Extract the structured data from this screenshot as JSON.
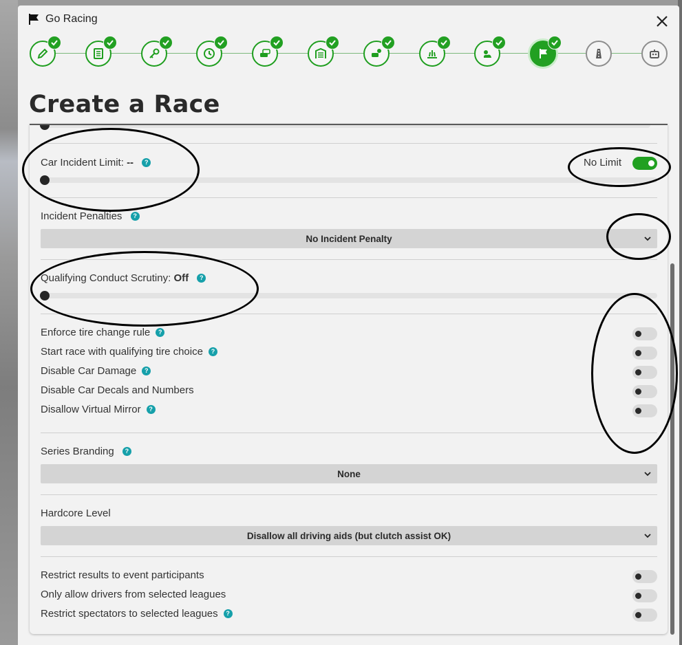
{
  "window": {
    "title": "Go Racing"
  },
  "steps": [
    {
      "icon": "pencil-icon",
      "done": true
    },
    {
      "icon": "list-icon",
      "done": true
    },
    {
      "icon": "key-icon",
      "done": true
    },
    {
      "icon": "clock-icon",
      "done": true
    },
    {
      "icon": "cars-icon",
      "done": true
    },
    {
      "icon": "garage-icon",
      "done": true
    },
    {
      "icon": "car-settings-icon",
      "done": true
    },
    {
      "icon": "grass-icon",
      "done": true
    },
    {
      "icon": "weather-icon",
      "done": true
    },
    {
      "icon": "flag-icon",
      "done": true,
      "active": true
    },
    {
      "icon": "road-icon",
      "done": false
    },
    {
      "icon": "robot-icon",
      "done": false
    }
  ],
  "page": {
    "title": "Create a Race"
  },
  "form": {
    "car_incident_limit": {
      "label": "Car Incident Limit:",
      "value": "--",
      "no_limit_label": "No Limit",
      "no_limit_on": true
    },
    "incident_penalties": {
      "label": "Incident Penalties",
      "selected": "No Incident Penalty"
    },
    "qualifying_scrutiny": {
      "label": "Qualifying Conduct Scrutiny:",
      "value": "Off"
    },
    "toggles": [
      {
        "label": "Enforce tire change rule",
        "help": true,
        "on": false
      },
      {
        "label": "Start race with qualifying tire choice",
        "help": true,
        "on": false
      },
      {
        "label": "Disable Car Damage",
        "help": true,
        "on": false
      },
      {
        "label": "Disable Car Decals and Numbers",
        "help": false,
        "on": false
      },
      {
        "label": "Disallow Virtual Mirror",
        "help": true,
        "on": false
      }
    ],
    "series_branding": {
      "label": "Series Branding",
      "selected": "None"
    },
    "hardcore_level": {
      "label": "Hardcore Level",
      "selected": "Disallow all driving aids (but clutch assist OK)"
    },
    "restrictions": [
      {
        "label": "Restrict results to event participants",
        "help": false,
        "on": false
      },
      {
        "label": "Only allow drivers from selected leagues",
        "help": false,
        "on": false
      },
      {
        "label": "Restrict spectators to selected leagues",
        "help": true,
        "on": false
      }
    ],
    "help_glyph": "?"
  },
  "colors": {
    "accent_green": "#22a022",
    "help_teal": "#16a0aa"
  }
}
